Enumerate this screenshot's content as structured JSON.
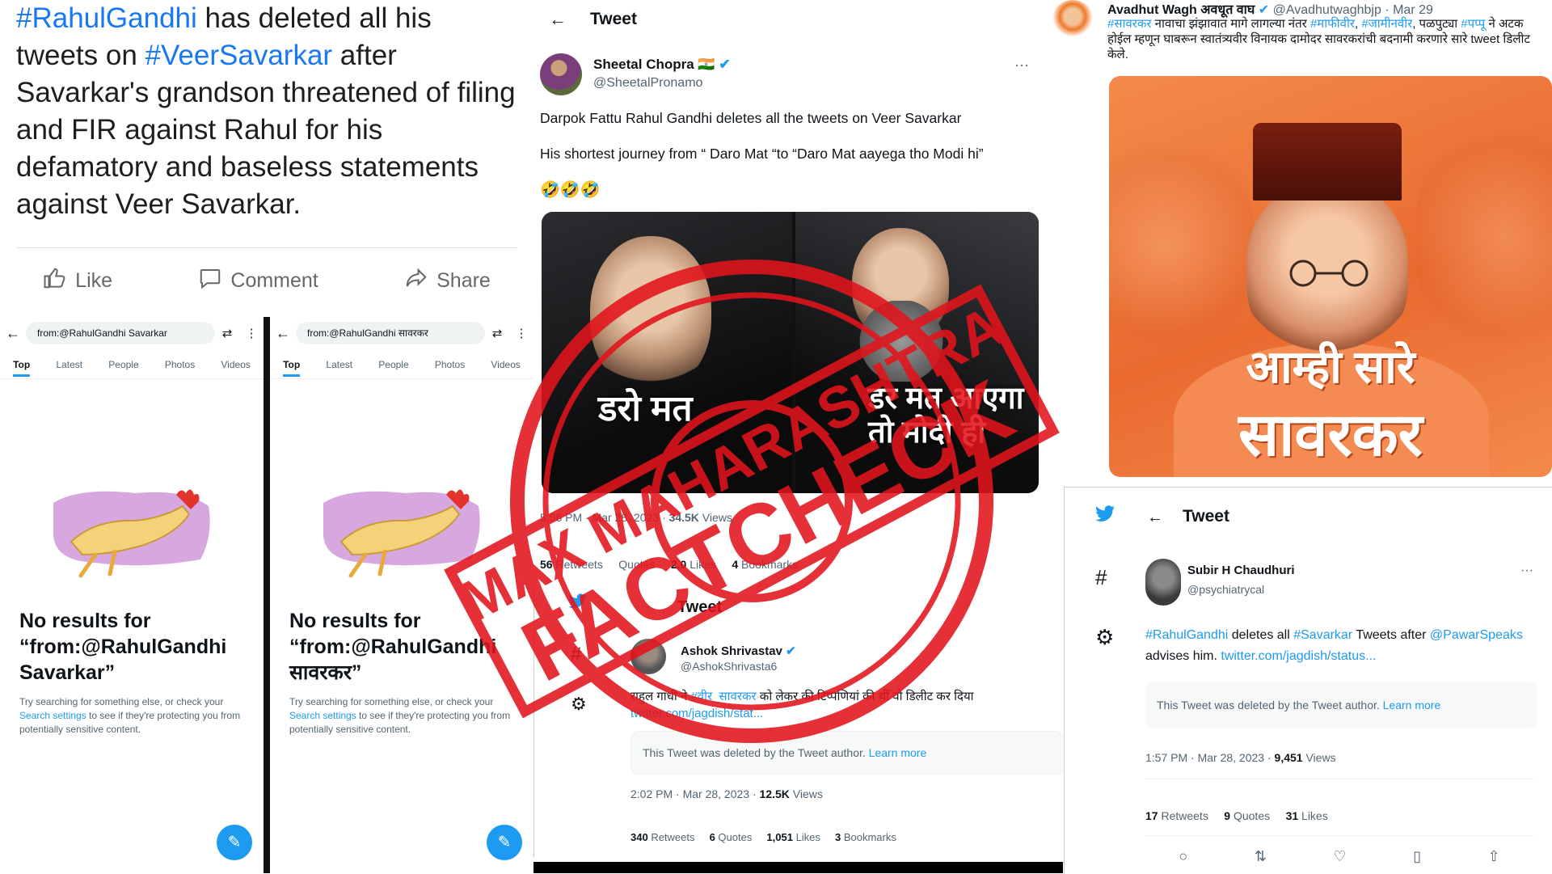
{
  "fb_post": {
    "hashtag1": "#RahulGandhi",
    "text1": " has deleted all his tweets on ",
    "hashtag2": "#VeerSavarkar",
    "text2": " after Savarkar's grandson threatened of filing and FIR against Rahul for his defamatory and baseless statements against Veer Savarkar.",
    "like": "Like",
    "comment": "Comment",
    "share": "Share"
  },
  "search_left": {
    "query": "from:@RahulGandhi Savarkar",
    "tabs": [
      "Top",
      "Latest",
      "People",
      "Photos",
      "Videos"
    ],
    "no_results": "No results for “from:@RahulGandhi Savarkar”",
    "help_pre": "Try searching for something else, or check your ",
    "help_link": "Search settings",
    "help_post": " to see if they're protecting you from potentially sensitive content."
  },
  "search_right": {
    "query": "from:@RahulGandhi सावरकर",
    "tabs": [
      "Top",
      "Latest",
      "People",
      "Photos",
      "Videos"
    ],
    "no_results": "No results for “from:@RahulGandhi सावरकर”",
    "help_pre": "Try searching for something else, or check your ",
    "help_link": "Search settings",
    "help_post": " to see if they're protecting you from potentially sensitive content."
  },
  "sheetal_tweet": {
    "header": "Tweet",
    "name": "Sheetal Chopra 🇮🇳",
    "handle": "@SheetalPronamo",
    "line1": "Darpok Fattu Rahul Gandhi deletes all the tweets on Veer Savarkar",
    "line2": "His shortest journey from “ Daro Mat “to “Daro Mat aayega tho Modi hi”",
    "emojis": "🤣🤣🤣",
    "image_left_caption": "डरो मत",
    "image_right_caption": "डर मत आएगा तो मोदी ही",
    "meta_time": "5:56 PM · Mar 28, 2023 · ",
    "meta_views_num": "34.5K",
    "meta_views_label": " Views",
    "retweets_num": "56",
    "retweets_label": " Retweets",
    "quotes_label": "Quotes",
    "likes_num": "2,0",
    "likes_label": " Likes",
    "bookmarks_num": "4",
    "bookmarks_label": " Bookmarks"
  },
  "ashok_tweet": {
    "header": "Tweet",
    "name": "Ashok Shrivastav",
    "handle": "@AshokShrivasta6",
    "body_pre": "राहुल गांधी ने ",
    "body_tag": "#वीर_सावरकर",
    "body_post": " को लेकर की टिप्पणियां की थीं वो डिलीट कर दिया",
    "body_link": "twitter.com/jagdish/stat...",
    "deleted_text": "This Tweet was deleted by the Tweet author. ",
    "learn_more": "Learn more",
    "meta_time": "2:02 PM · Mar 28, 2023 · ",
    "meta_views_num": "12.5K",
    "meta_views_label": " Views",
    "retweets": "340",
    "retweets_label": " Retweets",
    "quotes": "6",
    "quotes_label": " Quotes",
    "likes": "1,051",
    "likes_label": " Likes",
    "bookmarks": "3",
    "bookmarks_label": " Bookmarks"
  },
  "avadhut_tweet": {
    "name": "Avadhut Wagh अवधूत वाघ",
    "handle": "@Avadhutwaghbjp",
    "date": " · Mar 29",
    "body_tag1": "#सावरकर",
    "body_1": " नावाचा झंझावात मागे लागल्या नंतर ",
    "body_tag2": "#माफीवीर",
    "body_sep": ", ",
    "body_tag3": "#जामीनवीर",
    "body_2": ", पळपुट्या ",
    "body_tag4": "#पप्पू",
    "body_3": " ने अटक होईल म्हणून घाबरून स्वातंत्र्यवीर विनायक दामोदर सावरकरांची बदनामी करणारे सारे tweet डिलीट केले.",
    "poster_line1": "आम्ही सारे",
    "poster_line2": "सावरकर"
  },
  "subir_tweet": {
    "header": "Tweet",
    "name": "Subir H Chaudhuri",
    "handle": "@psychiatrycal",
    "tag1": "#RahulGandhi",
    "text1": " deletes all ",
    "tag2": "#Savarkar",
    "text2": " Tweets after ",
    "mention": "@PawarSpeaks",
    "text3": " advises him. ",
    "link": "twitter.com/jagdish/status...",
    "deleted_text": "This Tweet was deleted by the Tweet author. ",
    "learn_more": "Learn more",
    "meta_time": "1:57 PM · Mar 28, 2023 · ",
    "meta_views_num": "9,451",
    "meta_views_label": " Views",
    "retweets": "17",
    "retweets_label": " Retweets",
    "quotes": "9",
    "quotes_label": " Quotes",
    "likes": "31",
    "likes_label": " Likes"
  },
  "stamp": {
    "line1": "MAX MAHARASHTRA",
    "line2": "FACTCHECK",
    "color": "#e3141c"
  },
  "colors": {
    "twitter_blue": "#1d9bf0",
    "facebook_blue": "#1877f2",
    "poster_orange": "#ea6a2e"
  }
}
